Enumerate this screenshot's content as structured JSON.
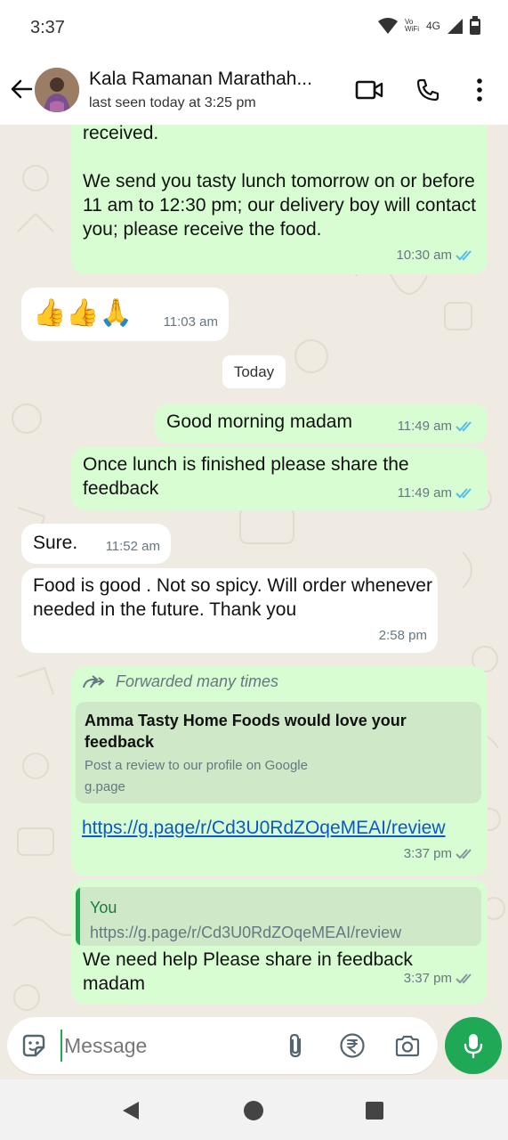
{
  "status_bar": {
    "time": "3:37",
    "volte": "Vo WiFi",
    "network": "4G"
  },
  "header": {
    "contact_name": "Kala Ramanan Marathah...",
    "last_seen": "last seen today at 3:25 pm"
  },
  "messages": [
    {
      "dir": "out",
      "text": "received.\n\nWe send you tasty lunch tomorrow on or before 11 am to 12:30 pm; our delivery boy will contact you; please receive the food.",
      "time": "10:30 am",
      "status": "read"
    },
    {
      "dir": "in",
      "text": "👍👍🙏",
      "time": "11:03 am"
    },
    {
      "dir": "out",
      "text": "Good morning madam",
      "time": "11:49 am",
      "status": "read"
    },
    {
      "dir": "out",
      "text": "Once lunch is finished please share the feedback",
      "time": "11:49 am",
      "status": "read"
    },
    {
      "dir": "in",
      "text": "Sure.",
      "time": "11:52 am"
    },
    {
      "dir": "in",
      "text": "Food is good . Not so spicy. Will order whenever needed in the future. Thank you",
      "time": "2:58 pm"
    },
    {
      "dir": "out",
      "forwarded_label": "Forwarded many times",
      "preview_title": "Amma Tasty Home Foods would love your feedback",
      "preview_desc": "Post a review to our profile on Google",
      "preview_domain": "g.page",
      "link": "https://g.page/r/Cd3U0RdZOqeMEAI/review",
      "time": "3:37 pm",
      "status": "delivered"
    },
    {
      "dir": "out",
      "reply_author": "You",
      "reply_text": "https://g.page/r/Cd3U0RdZOqeMEAI/review",
      "text": "We need help Please share in feedback madam",
      "time": "3:37 pm",
      "status": "delivered"
    }
  ],
  "date_divider": "Today",
  "composer": {
    "placeholder": "Message"
  },
  "colors": {
    "accent": "#1fa855",
    "outgoing_bubble": "#d9fdd3",
    "incoming_bubble": "#ffffff",
    "read_tick": "#53bdeb",
    "wallpaper": "#efeae2"
  },
  "icons": [
    "back-arrow-icon",
    "video-call-icon",
    "phone-icon",
    "more-options-icon",
    "sticker-icon",
    "attach-icon",
    "rupee-payment-icon",
    "camera-icon",
    "mic-icon",
    "nav-back-icon",
    "nav-home-icon",
    "nav-recents-icon"
  ]
}
